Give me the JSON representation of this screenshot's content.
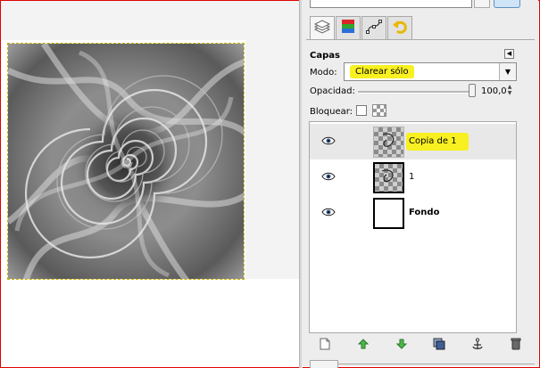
{
  "layers_dialog": {
    "title": "Capas",
    "mode": {
      "label": "Modo:",
      "value": "Clarear sólo"
    },
    "opacity": {
      "label": "Opacidad:",
      "value": "100,0",
      "level_percent": 100
    },
    "lock": {
      "label": "Bloquear:"
    },
    "layers": [
      {
        "name": "Copia de 1",
        "visible": true,
        "selected": true,
        "highlighted": true
      },
      {
        "name": "1",
        "visible": true,
        "selected": false,
        "highlighted": false
      },
      {
        "name": "Fondo",
        "visible": true,
        "selected": false,
        "highlighted": false
      }
    ]
  },
  "tab_icons": [
    "layers-icon",
    "channels-icon",
    "paths-icon",
    "undo-history-icon"
  ],
  "bottom_icons": [
    "new-layer-icon",
    "raise-layer-icon",
    "lower-layer-icon",
    "duplicate-layer-icon",
    "anchor-layer-icon",
    "delete-layer-icon"
  ],
  "colors": {
    "highlight": "#f8f020",
    "frame_border": "#e00000",
    "panel_bg": "#ededed",
    "selected_row": "#e8e8e8"
  }
}
